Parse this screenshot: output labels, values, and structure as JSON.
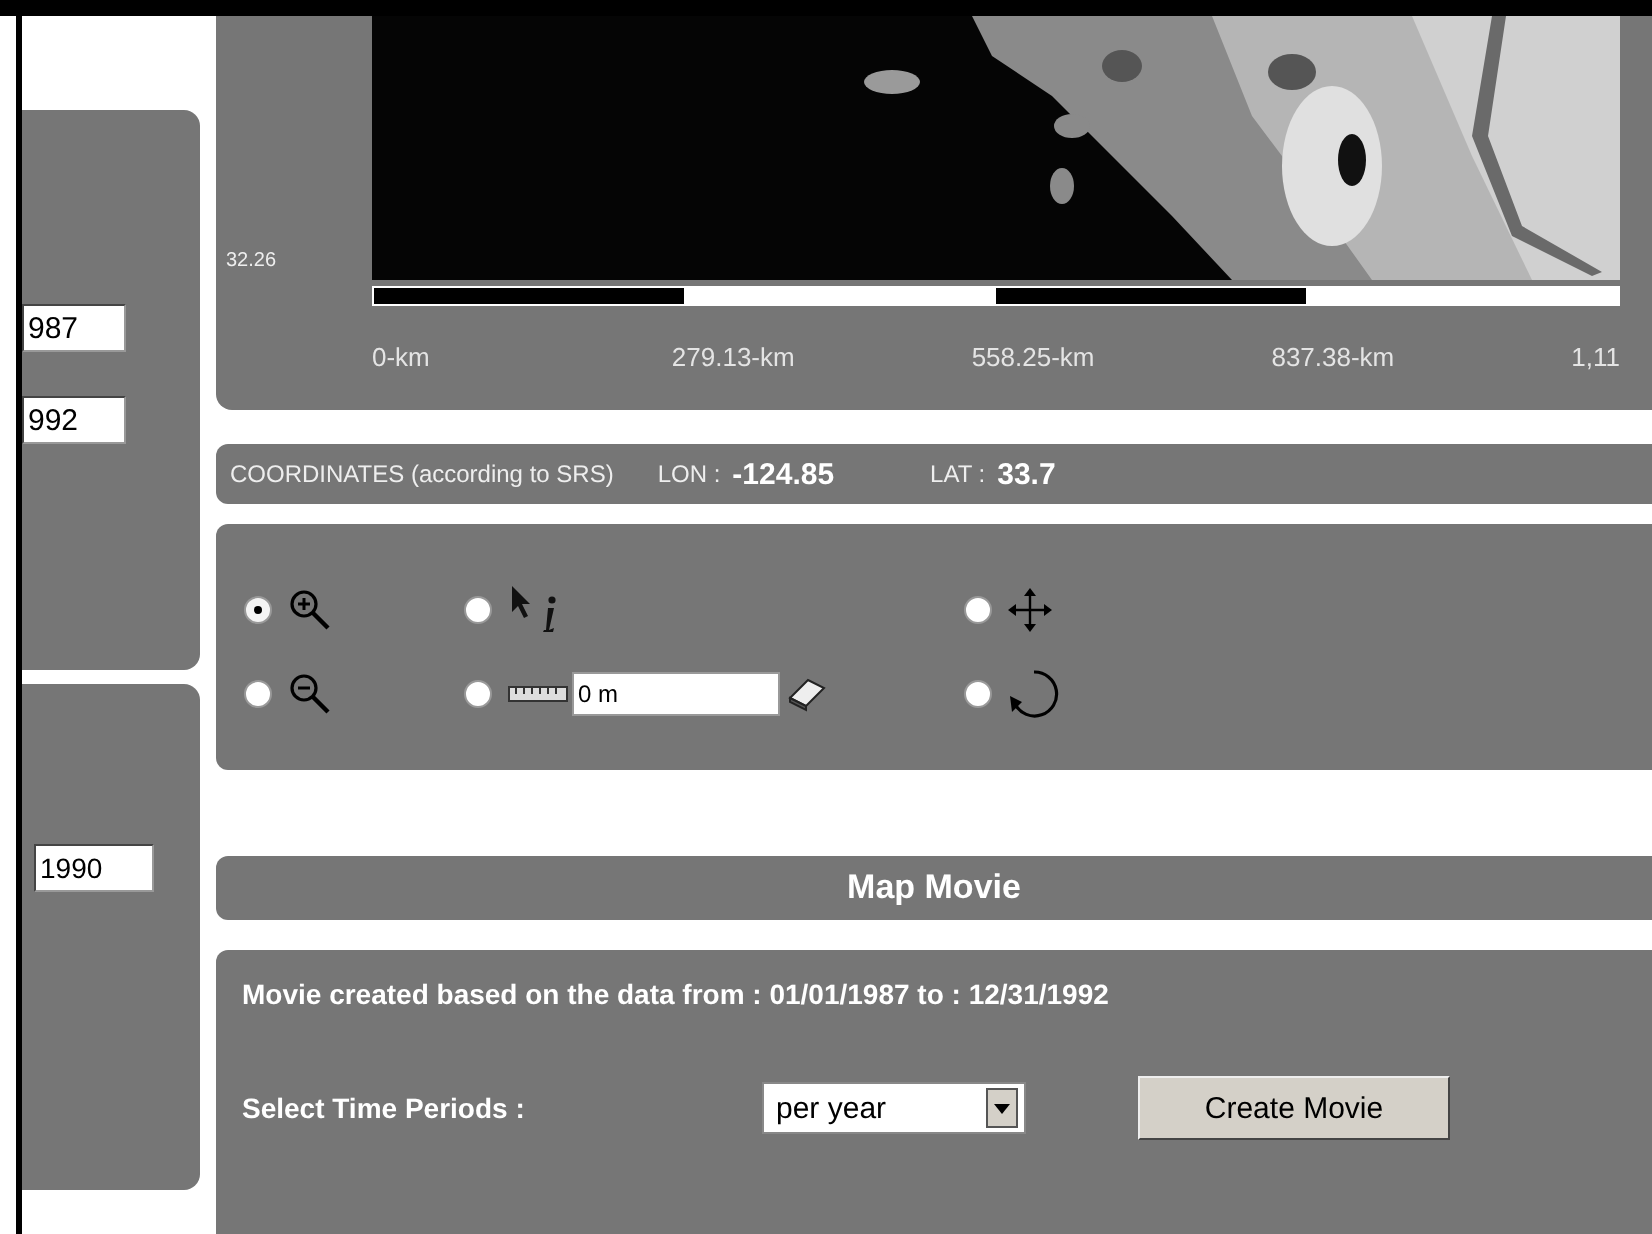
{
  "left_panels": [
    {
      "fields": [
        "987",
        "992"
      ]
    },
    {
      "fields": [
        "1990"
      ]
    }
  ],
  "map": {
    "latitude_label": "32.26",
    "scale_labels": [
      "0-km",
      "279.13-km",
      "558.25-km",
      "837.38-km",
      "1,11"
    ]
  },
  "coordinates": {
    "label": "COORDINATES (according to SRS)",
    "lon_label": "LON :",
    "lon": "-124.85",
    "lat_label": "LAT :",
    "lat": "33.7"
  },
  "tools": [
    {
      "kind": "zoom-in",
      "selected": true
    },
    {
      "kind": "info",
      "selected": false
    },
    {
      "kind": "pan",
      "selected": false
    },
    {
      "kind": "zoom-out",
      "selected": false
    },
    {
      "kind": "measure",
      "selected": false,
      "value": "0 m"
    },
    {
      "kind": "rotate",
      "selected": false
    }
  ],
  "movie": {
    "title": "Map Movie",
    "description": "Movie created based on the data from : 01/01/1987 to : 12/31/1992",
    "period_label": "Select Time Periods :",
    "period": "per year",
    "button": "Create Movie"
  }
}
